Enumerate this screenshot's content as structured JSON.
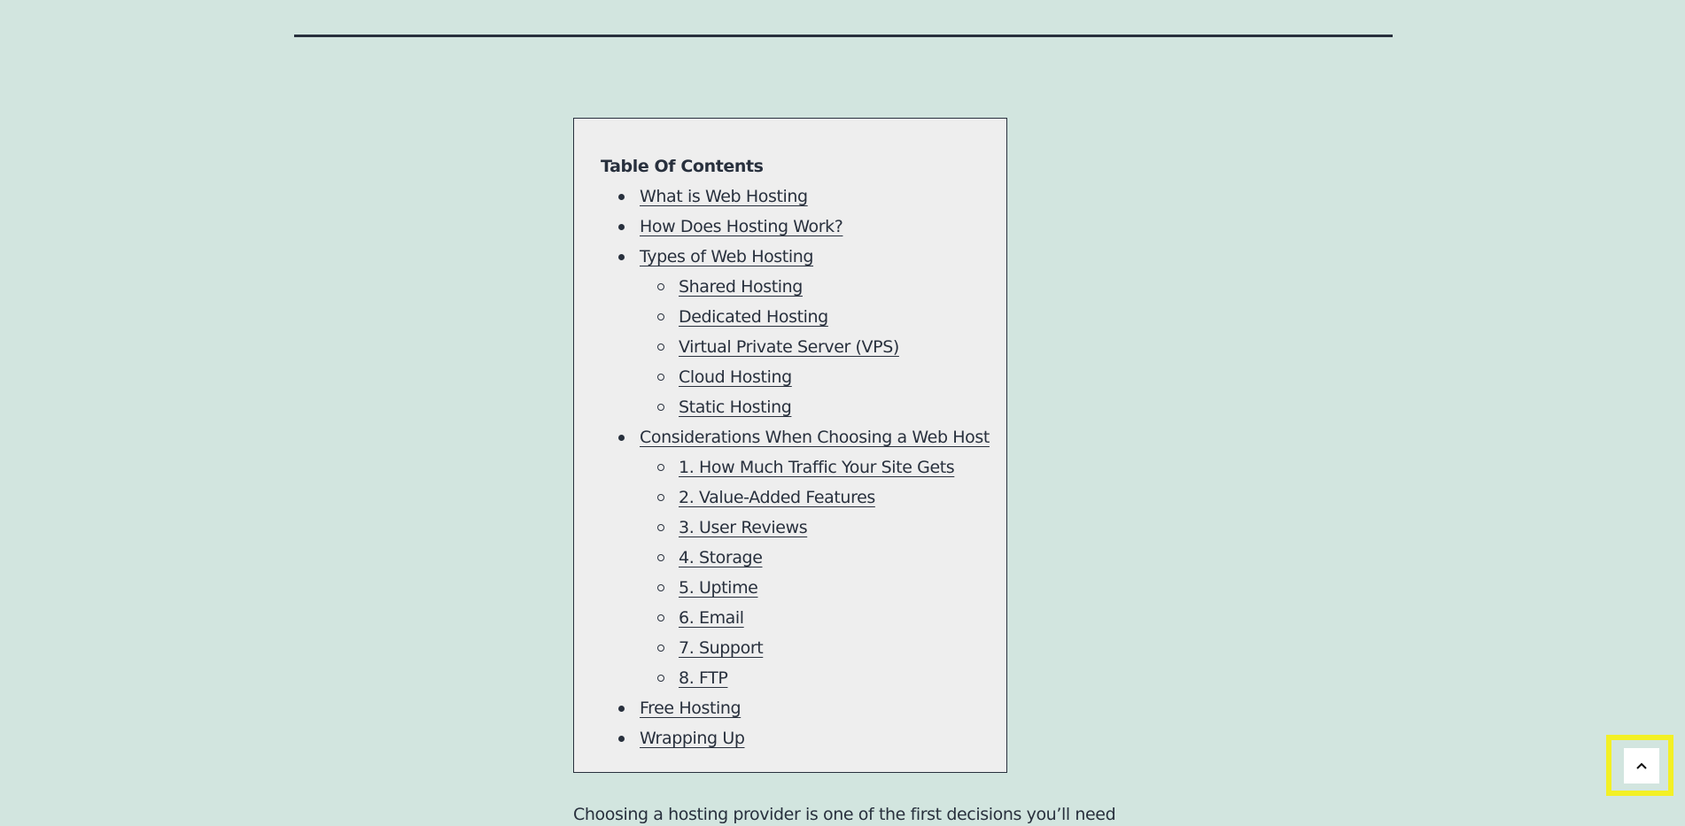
{
  "toc": {
    "title": "Table Of Contents",
    "items": [
      {
        "label": "What is Web Hosting",
        "level": 1
      },
      {
        "label": "How Does Hosting Work?",
        "level": 1
      },
      {
        "label": "Types of Web Hosting",
        "level": 1
      },
      {
        "label": "Shared Hosting",
        "level": 2
      },
      {
        "label": "Dedicated Hosting",
        "level": 2
      },
      {
        "label": "Virtual Private Server (VPS)",
        "level": 2
      },
      {
        "label": "Cloud Hosting",
        "level": 2
      },
      {
        "label": "Static Hosting",
        "level": 2
      },
      {
        "label": "Considerations When Choosing a Web Host",
        "level": 1
      },
      {
        "label": "1. How Much Traffic Your Site Gets",
        "level": 2
      },
      {
        "label": "2. Value-Added Features",
        "level": 2
      },
      {
        "label": "3. User Reviews",
        "level": 2
      },
      {
        "label": "4. Storage",
        "level": 2
      },
      {
        "label": "5. Uptime",
        "level": 2
      },
      {
        "label": "6. Email",
        "level": 2
      },
      {
        "label": "7. Support",
        "level": 2
      },
      {
        "label": "8. FTP",
        "level": 2
      },
      {
        "label": "Free Hosting",
        "level": 1
      },
      {
        "label": "Wrapping Up",
        "level": 1
      }
    ]
  },
  "intro_text": "Choosing a hosting provider is one of the first decisions you’ll need",
  "scroll_top": {
    "icon": "chevron-up-icon",
    "highlight_color": "#f3f025"
  }
}
